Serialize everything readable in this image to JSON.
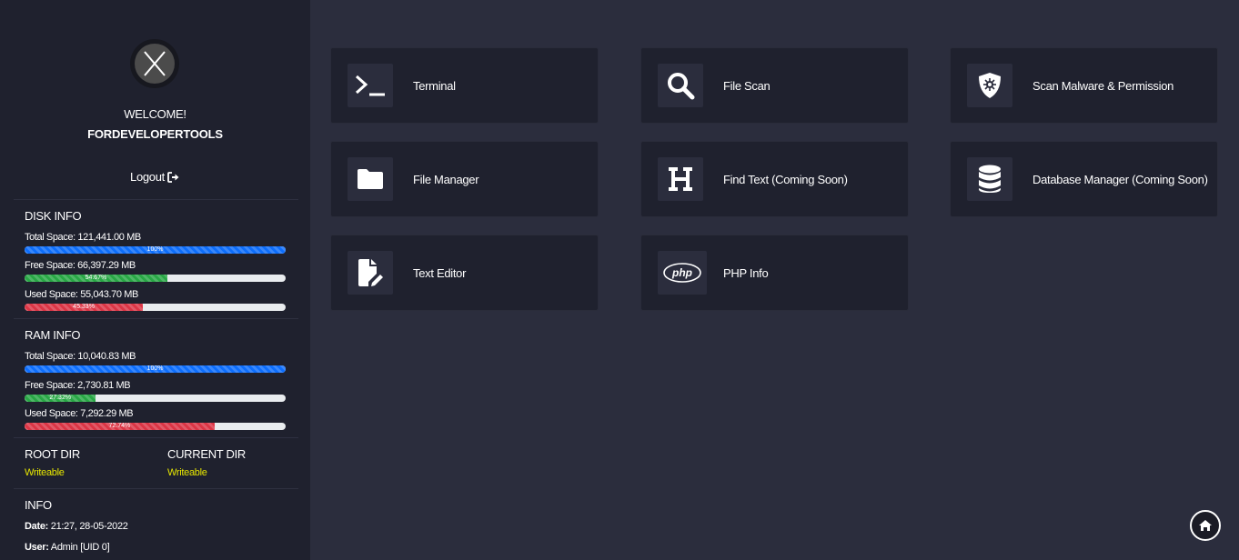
{
  "sidebar": {
    "welcome": "WELCOME!",
    "username": "FORDEVELOPERTOOLS",
    "logout_label": "Logout",
    "disk": {
      "title": "DISK INFO",
      "total_label": "Total Space: 121,441.00 MB",
      "total_pct": "100%",
      "total_fraction": 1.0,
      "free_label": "Free Space: 66,397.29 MB",
      "free_pct": "54.67%",
      "free_fraction": 0.5467,
      "used_label": "Used Space: 55,043.70 MB",
      "used_pct": "45.33%",
      "used_fraction": 0.4533
    },
    "ram": {
      "title": "RAM INFO",
      "total_label": "Total Space: 10,040.83 MB",
      "total_pct": "100%",
      "total_fraction": 1.0,
      "free_label": "Free Space: 2,730.81 MB",
      "free_pct": "27.32%",
      "free_fraction": 0.2732,
      "used_label": "Used Space: 7,292.29 MB",
      "used_pct": "72.74%",
      "used_fraction": 0.7274
    },
    "root_dir": {
      "title": "ROOT DIR",
      "value": "Writeable"
    },
    "current_dir": {
      "title": "CURRENT DIR",
      "value": "Writeable"
    },
    "info": {
      "title": "INFO",
      "date_key": "Date:",
      "date_value": "21:27, 28-05-2022",
      "user_key": "User:",
      "user_value": "Admin [UID 0]"
    }
  },
  "tools": {
    "terminal": "Terminal",
    "file_scan": "File Scan",
    "scan_malware": "Scan Malware & Permission",
    "file_manager": "File Manager",
    "find_text": "Find Text (Coming Soon)",
    "database_manager": "Database Manager (Coming Soon)",
    "text_editor": "Text Editor",
    "php_info": "PHP Info",
    "php_logo_text": "php"
  },
  "colors": {
    "bg_main": "#2b2d3d",
    "bg_sidebar": "#1f212e",
    "progress_blue": "#0d6efd",
    "progress_green": "#28a745",
    "progress_red": "#dc3545",
    "writeable": "#e6e600"
  }
}
